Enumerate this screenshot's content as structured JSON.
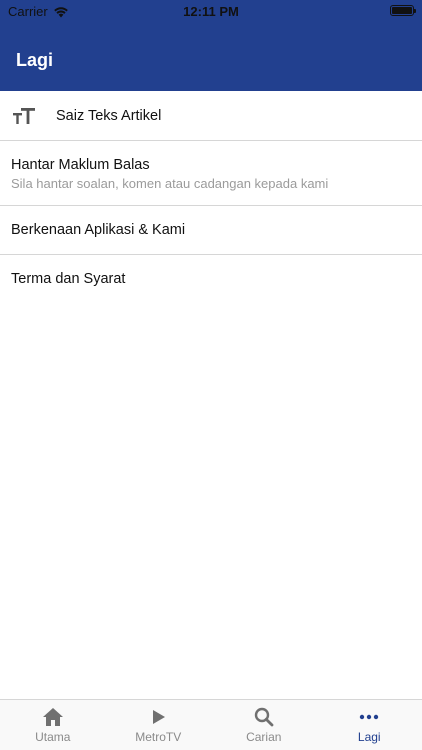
{
  "status_bar": {
    "carrier": "Carrier",
    "time": "12:11 PM"
  },
  "nav": {
    "title": "Lagi"
  },
  "menu": {
    "font_size": {
      "label": "Saiz Teks Artikel",
      "icon": "text-size-icon"
    },
    "feedback": {
      "label": "Hantar Maklum Balas",
      "sublabel": "Sila hantar soalan, komen atau cadangan kepada kami"
    },
    "about": {
      "label": "Berkenaan Aplikasi & Kami"
    },
    "terms": {
      "label": "Terma dan Syarat"
    }
  },
  "tabs": [
    {
      "label": "Utama",
      "icon": "home-icon",
      "active": false
    },
    {
      "label": "MetroTV",
      "icon": "play-icon",
      "active": false
    },
    {
      "label": "Carian",
      "icon": "search-icon",
      "active": false
    },
    {
      "label": "Lagi",
      "icon": "more-icon",
      "active": true
    }
  ],
  "colors": {
    "brand": "#22408f",
    "tab_inactive": "#8a8a8a",
    "divider": "#d6d6d6",
    "sublabel": "#9b9b9b"
  }
}
